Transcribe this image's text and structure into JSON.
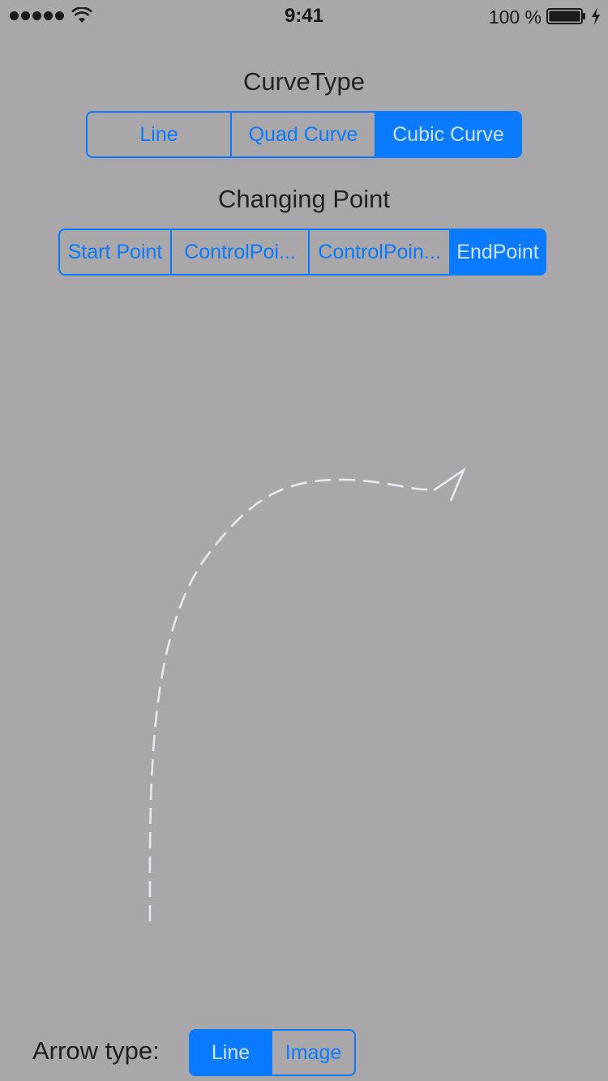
{
  "status_bar": {
    "time": "9:41",
    "battery_percent": "100 %",
    "signal_icon": "signal-dots-icon",
    "wifi_icon": "wifi-icon",
    "battery_icon": "battery-icon",
    "charging_icon": "charging-bolt-icon"
  },
  "curve_type": {
    "title": "CurveType",
    "options": [
      "Line",
      "Quad Curve",
      "Cubic Curve"
    ],
    "selected": "Cubic Curve"
  },
  "changing_point": {
    "title": "Changing Point",
    "options": [
      "Start Point",
      "ControlPoi...",
      "ControlPoin...",
      "EndPoint"
    ],
    "selected": "EndPoint"
  },
  "arrow_type": {
    "label": "Arrow type:",
    "options": [
      "Line",
      "Image"
    ],
    "selected": "Line"
  },
  "colors": {
    "background": "#a9a7aa",
    "accent": "#0a7aff",
    "curve_stroke": "#e6e8f2"
  }
}
